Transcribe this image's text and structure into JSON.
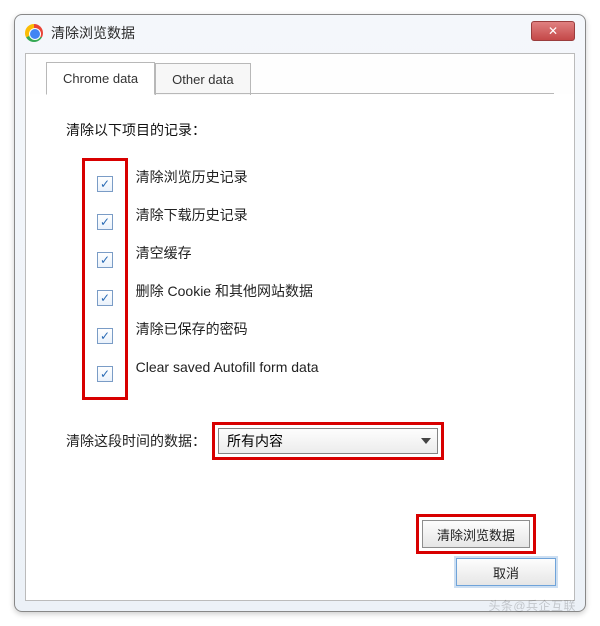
{
  "window": {
    "title": "清除浏览数据",
    "close_glyph": "✕"
  },
  "tabs": {
    "chrome": "Chrome data",
    "other": "Other data"
  },
  "content": {
    "heading": "清除以下项目的记录：",
    "period_label": "清除这段时间的数据：",
    "period_value": "所有内容"
  },
  "options": [
    {
      "label": "清除浏览历史记录",
      "checked": true
    },
    {
      "label": "清除下载历史记录",
      "checked": true
    },
    {
      "label": "清空缓存",
      "checked": true
    },
    {
      "label": "删除 Cookie 和其他网站数据",
      "checked": true
    },
    {
      "label": "清除已保存的密码",
      "checked": true
    },
    {
      "label": "Clear saved Autofill form data",
      "checked": true
    }
  ],
  "buttons": {
    "clear": "清除浏览数据",
    "cancel": "取消"
  },
  "watermark": "头条@兵企互联"
}
